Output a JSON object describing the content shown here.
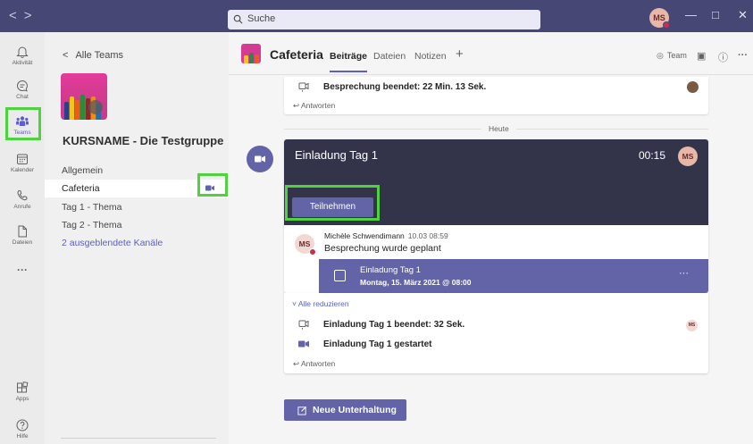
{
  "titlebar": {
    "nav_back": "<",
    "nav_forward": ">",
    "search_placeholder": "Suche",
    "avatar": "MS",
    "minimize": "—",
    "maximize": "□",
    "close": "✕"
  },
  "rail": {
    "items": [
      {
        "label": "Aktivität",
        "icon": "bell-icon"
      },
      {
        "label": "Chat",
        "icon": "chat-icon"
      },
      {
        "label": "Teams",
        "icon": "teams-icon"
      },
      {
        "label": "Kalender",
        "icon": "calendar-icon"
      },
      {
        "label": "Anrufe",
        "icon": "phone-icon"
      },
      {
        "label": "Dateien",
        "icon": "file-icon"
      }
    ],
    "more": "···",
    "apps": "Apps",
    "help": "Hilfe",
    "active_color": "#5b5fc7",
    "highlight_color": "#4ed23e"
  },
  "panel": {
    "back": "Alle Teams",
    "team_name": "KURSNAME - Die Testgruppe",
    "channels": [
      "Allgemein",
      "Cafeteria",
      "Tag 1 - Thema",
      "Tag 2 - Thema"
    ],
    "hidden_channels": "2 ausgeblendete Kanäle"
  },
  "header": {
    "title": "Cafeteria",
    "tabs": [
      "Beiträge",
      "Dateien",
      "Notizen"
    ],
    "add_tab": "+",
    "team_button": "Team",
    "more": "···"
  },
  "feed": {
    "prev_meeting_ended": "Besprechung beendet: 22 Min. 13 Sek.",
    "reply": "Antworten",
    "date_divider": "Heute",
    "meeting": {
      "title": "Einladung Tag 1",
      "time": "00:15",
      "avatar": "MS",
      "join_button": "Teilnehmen",
      "author": "Michèle Schwendimann",
      "timestamp": "10.03 08:59",
      "message": "Besprechung wurde geplant",
      "invite_title": "Einladung Tag 1",
      "invite_date": "Montag, 15. März 2021 @ 08:00",
      "invite_more": "···"
    },
    "collapse_all": "Alle reduzieren",
    "ended": "Einladung Tag 1 beendet: 32 Sek.",
    "ended_avatar": "MS",
    "started": "Einladung Tag 1 gestartet",
    "reply2": "Antworten",
    "new_conversation": "Neue Unterhaltung"
  },
  "colors": {
    "titlebar": "#464775",
    "accent": "#6264a7",
    "meeting_header": "#33344a",
    "team_pink": "#d53b92"
  }
}
